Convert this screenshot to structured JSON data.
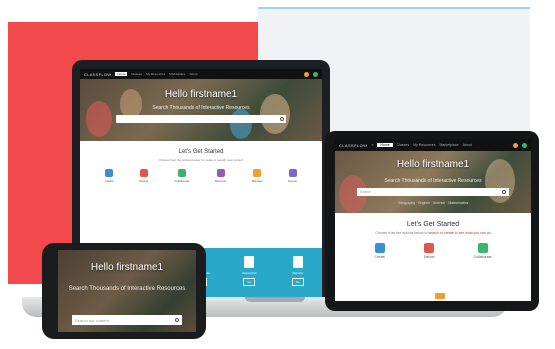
{
  "brand": "CLASSFLOW",
  "colors": {
    "accent_red": "#f2494d",
    "teal": "#2aa8c9",
    "device_frame": "#1e1f22"
  },
  "laptop": {
    "nav_items": [
      "Home",
      "Classes",
      "My Resources",
      "Marketplace",
      "About"
    ],
    "hero_title": "Hello firstname1",
    "hero_subtitle": "Search Thousands of Interactive Resources",
    "started_title": "Let's Get Started",
    "started_text": "Choose from the options below to create or search new content",
    "actions": [
      "Create",
      "Deliver",
      "Collaborate",
      "Discover",
      "Manage",
      "Report"
    ],
    "cards": [
      {
        "title": "Classes",
        "button": "Go"
      },
      {
        "title": "Lessons",
        "button": "Go"
      },
      {
        "title": "Assessments",
        "button": "Go"
      },
      {
        "title": "Resources",
        "button": "Go"
      },
      {
        "title": "Reports",
        "button": "Go"
      }
    ]
  },
  "tablet": {
    "nav_items": [
      "Home",
      "Classes",
      "My Resources",
      "Marketplace",
      "About"
    ],
    "hero_title": "Hello firstname1",
    "hero_subtitle": "Search Thousands of Interactive Resources",
    "search_placeholder": "Search",
    "tags": "Geography · English · Science · Mathematics",
    "started_title": "Let's Get Started",
    "started_text_prefix": "Choose from the options below to ",
    "started_link": "search or create to see what you can do",
    "actions": [
      "Create",
      "Deliver",
      "Collaborate"
    ]
  },
  "phone": {
    "hero_title": "Hello firstname1",
    "hero_subtitle": "Search Thousands of Interactive Resources",
    "search_placeholder": "Search our content"
  }
}
